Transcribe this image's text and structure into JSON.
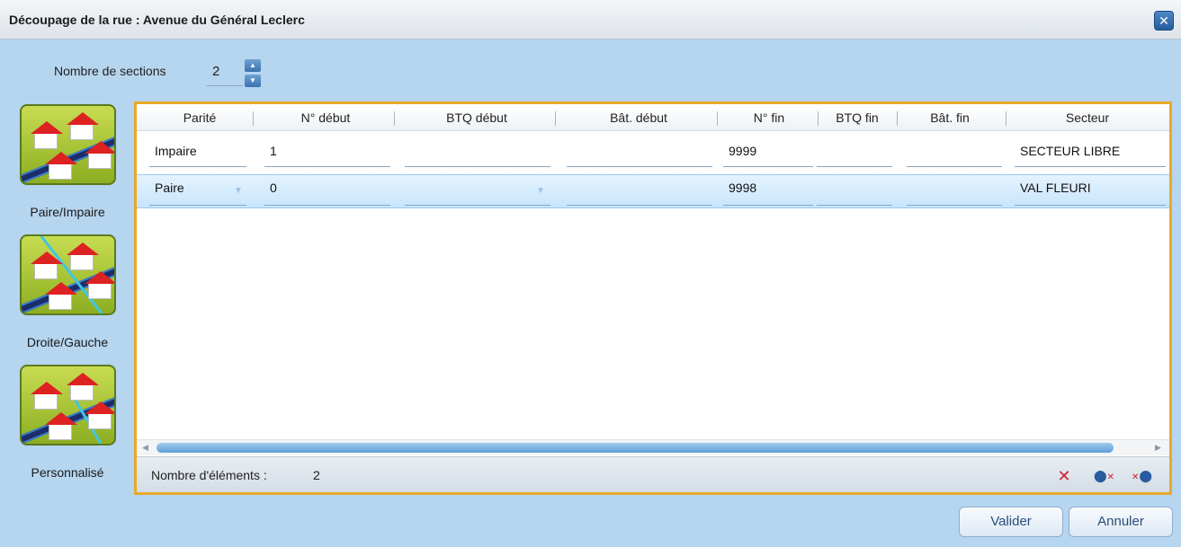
{
  "window": {
    "title": "Découpage de la rue : Avenue du Général Leclerc",
    "close_icon": "close-icon"
  },
  "sections": {
    "label": "Nombre de sections",
    "value": "2"
  },
  "modes": [
    {
      "label": "Paire/Impaire"
    },
    {
      "label": "Droite/Gauche"
    },
    {
      "label": "Personnalisé"
    }
  ],
  "grid": {
    "columns": [
      "Parité",
      "N° début",
      "BTQ début",
      "Bât. début",
      "N° fin",
      "BTQ fin",
      "Bât. fin",
      "Secteur"
    ],
    "rows": [
      {
        "parite": "Impaire",
        "num_debut": "1",
        "btq_debut": "",
        "bat_debut": "",
        "num_fin": "9999",
        "btq_fin": "",
        "bat_fin": "",
        "secteur": "SECTEUR LIBRE"
      },
      {
        "parite": "Paire",
        "num_debut": "0",
        "btq_debut": "",
        "bat_debut": "",
        "num_fin": "9998",
        "btq_fin": "",
        "bat_fin": "",
        "secteur": "VAL FLEURI"
      }
    ]
  },
  "footer": {
    "count_label": "Nombre d'éléments :",
    "count_value": "2"
  },
  "buttons": {
    "validate": "Valider",
    "cancel": "Annuler"
  },
  "colors": {
    "accent_border": "#e9a92a",
    "selected_row": "#c7e5fb",
    "background": "#b6d5ef"
  }
}
